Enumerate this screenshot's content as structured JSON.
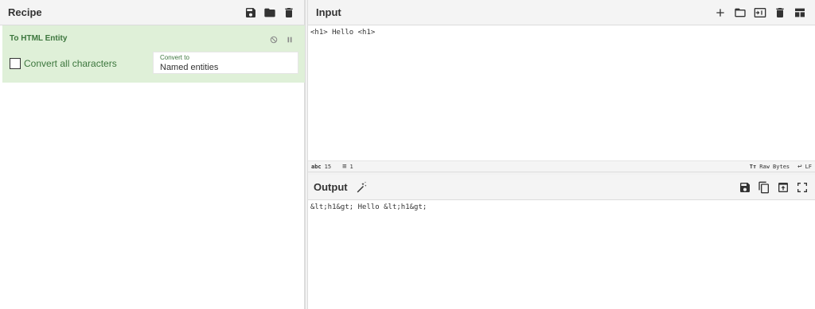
{
  "recipe": {
    "title": "Recipe",
    "operation": {
      "title": "To HTML Entity",
      "checkbox_label": "Convert all characters",
      "checkbox_checked": false,
      "select_label": "Convert to",
      "select_value": "Named entities"
    }
  },
  "input": {
    "title": "Input",
    "text": "<h1> Hello <h1>",
    "status": {
      "length": "15",
      "lines": "1",
      "encoding": "Raw Bytes",
      "eol": "LF"
    }
  },
  "output": {
    "title": "Output",
    "text": "&lt;h1&gt; Hello &lt;h1&gt;"
  },
  "colors": {
    "op_background": "#dff0d8",
    "op_text": "#3c763d",
    "header_background": "#f4f4f4"
  }
}
